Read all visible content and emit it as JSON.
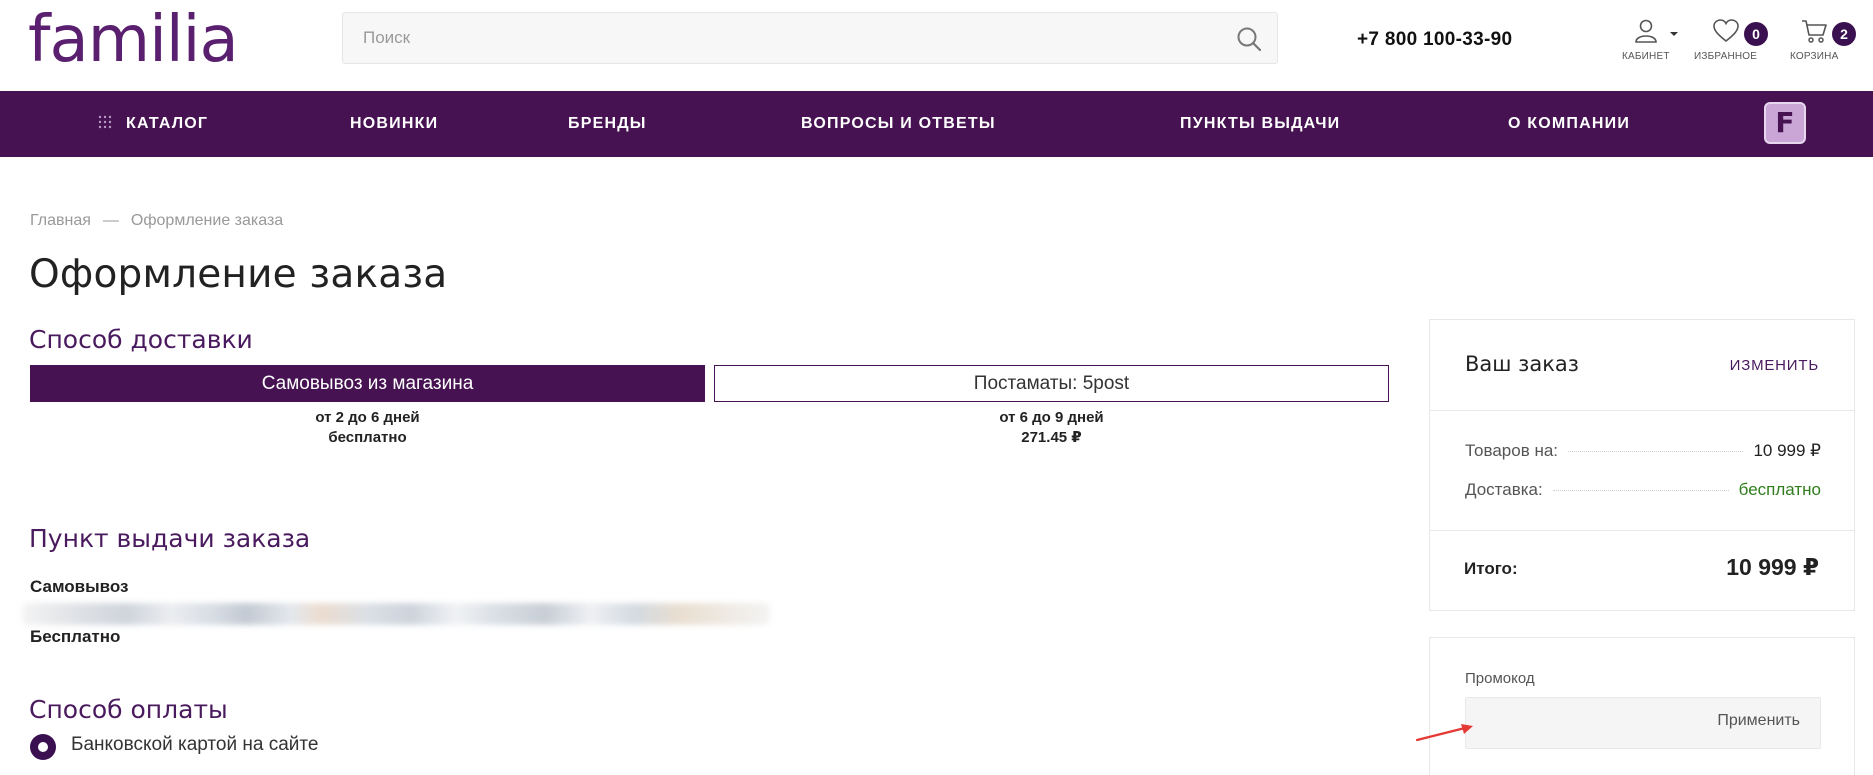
{
  "header": {
    "logo_text": "familia",
    "search_placeholder": "Поиск",
    "phone": "+7 800 100-33-90",
    "account_label": "КАБИНЕТ",
    "favorites_label": "ИЗБРАННОЕ",
    "favorites_count": "0",
    "cart_label": "КОРЗИНА",
    "cart_count": "2"
  },
  "nav": {
    "catalog": "КАТАЛОГ",
    "new": "НОВИНКИ",
    "brands": "БРЕНДЫ",
    "faq": "ВОПРОСЫ И ОТВЕТЫ",
    "pickup_points": "ПУНКТЫ ВЫДАЧИ",
    "about": "О КОМПАНИИ",
    "brand_badge": "F"
  },
  "breadcrumb": {
    "home": "Главная",
    "separator": "—",
    "current": "Оформление заказа"
  },
  "page_title": "Оформление заказа",
  "delivery": {
    "title": "Способ доставки",
    "options": [
      {
        "label": "Самовывоз из магазина",
        "time": "от 2 до 6 дней",
        "price": "бесплатно"
      },
      {
        "label": "Постаматы: 5post",
        "time": "от 6 до 9 дней",
        "price": "271.45 ₽"
      }
    ]
  },
  "pickup": {
    "title": "Пункт выдачи заказа",
    "method": "Самовывоз",
    "cost": "Бесплатно"
  },
  "payment": {
    "title": "Способ оплаты",
    "option": "Банковской картой на сайте"
  },
  "summary": {
    "title": "Ваш заказ",
    "edit": "ИЗМЕНИТЬ",
    "goods_label": "Товаров на:",
    "goods_value": "10 999 ₽",
    "delivery_label": "Доставка:",
    "delivery_value": "бесплатно",
    "total_label": "Итого:",
    "total_value": "10 999 ₽"
  },
  "promo": {
    "label": "Промокод",
    "apply": "Применить"
  },
  "colors": {
    "brand_purple": "#461252",
    "badge": "#3a1050",
    "green": "#2f7d1d",
    "annotation_arrow": "#e53935"
  }
}
